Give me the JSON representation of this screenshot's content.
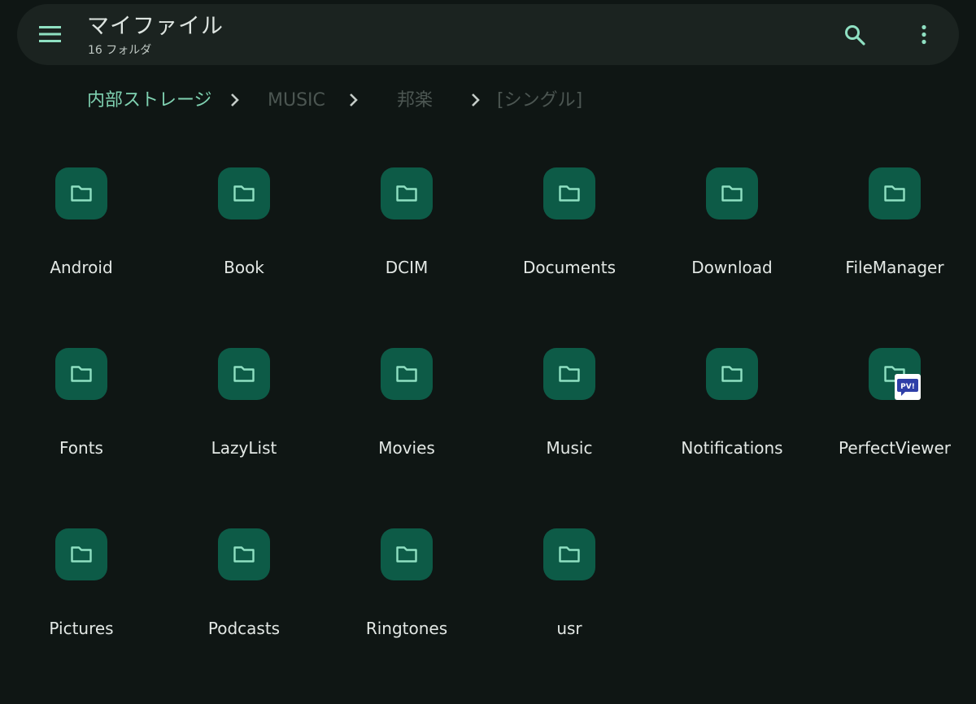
{
  "header": {
    "title": "マイファイル",
    "subtitle": "16 フォルダ",
    "menu_icon": "hamburger-menu-icon",
    "search_icon": "search-icon",
    "more_icon": "more-vertical-icon"
  },
  "breadcrumb": [
    "内部ストレージ",
    "MUSIC",
    "邦楽",
    "[シングル]"
  ],
  "folders": [
    "Android",
    "Book",
    "DCIM",
    "Documents",
    "Download",
    "FileManager",
    "Fonts",
    "LazyList",
    "Movies",
    "Music",
    "Notifications",
    "PerfectViewer",
    "Pictures",
    "Podcasts",
    "Ringtones",
    "usr"
  ],
  "badge": {
    "folder": "PerfectViewer",
    "text": "PV!",
    "icon": "perfectviewer-app-icon"
  },
  "colors": {
    "background": "#0f1614",
    "topbar": "#1b2320",
    "accent": "#7fd1b1",
    "folder_bg": "#0d5b47",
    "folder_icon": "#8fe0c2",
    "text": "#e3e8e5",
    "dim_text": "#4c5652"
  }
}
